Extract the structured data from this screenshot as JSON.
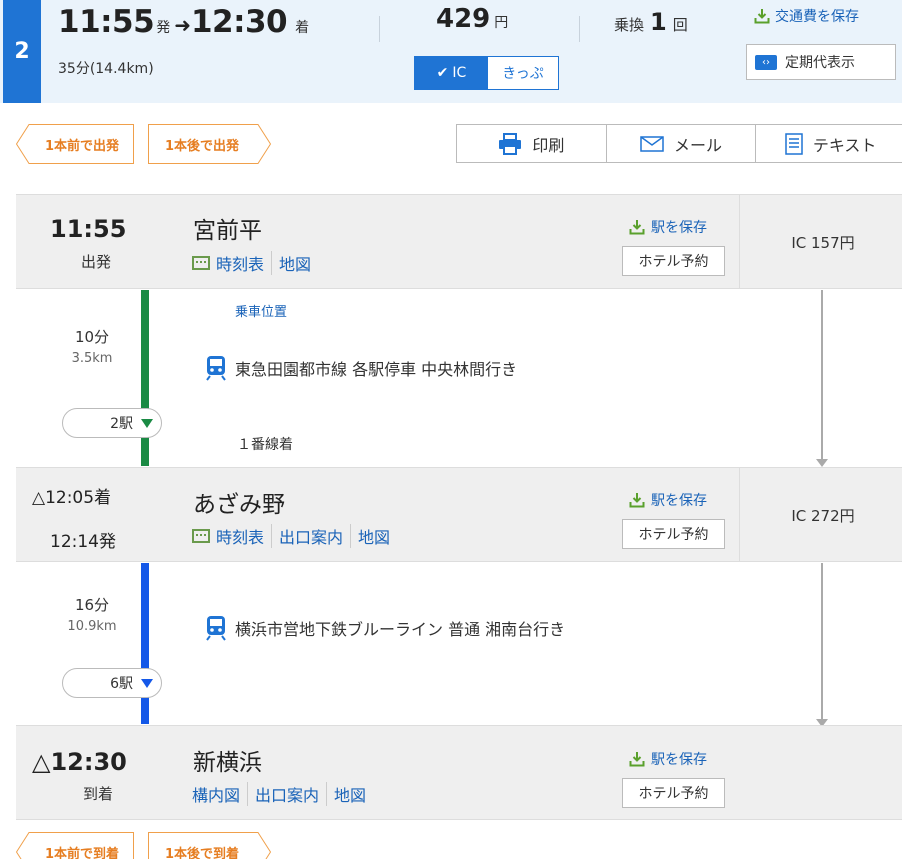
{
  "route": {
    "rank": "2",
    "depart_time": "11:55",
    "depart_suffix": "発",
    "arrive_time": "12:30",
    "arrive_suffix": "着",
    "duration": "35分(14.4km)",
    "fare_amount": "429",
    "fare_unit": "円",
    "transfer_label": "乗換",
    "transfer_count": "1",
    "transfer_unit": "回",
    "save_fare_label": "交通費を保存",
    "teiki_label": "定期代表示",
    "toggle_ic": "IC",
    "toggle_ticket": "きっぷ"
  },
  "nav": {
    "prev_depart": "1本前で出発",
    "next_depart": "1本後で出発",
    "prev_arrive": "1本前で到着",
    "next_arrive": "1本後で到着"
  },
  "actions": {
    "print": "印刷",
    "mail": "メール",
    "text": "テキスト"
  },
  "stations": [
    {
      "time_main": "11:55",
      "time_sub": "出発",
      "name": "宮前平",
      "links": [
        "時刻表",
        "地図"
      ],
      "save_label": "駅を保存",
      "hotel_label": "ホテル予約",
      "ic_fare": "IC 157円"
    },
    {
      "arr_time": "△12:05着",
      "dep_time": "12:14発",
      "name": "あざみ野",
      "links": [
        "時刻表",
        "出口案内",
        "地図"
      ],
      "save_label": "駅を保存",
      "hotel_label": "ホテル予約",
      "ic_fare": "IC 272円"
    },
    {
      "time_main": "△12:30",
      "time_sub": "到着",
      "name": "新横浜",
      "links": [
        "構内図",
        "出口案内",
        "地図"
      ],
      "save_label": "駅を保存",
      "hotel_label": "ホテル予約"
    }
  ],
  "segments": [
    {
      "minutes": "10分",
      "distance": "3.5km",
      "boarding_position": "乗車位置",
      "line": "東急田園都市線 各駅停車 中央林間行き",
      "stops": "2駅",
      "platform": "１番線着",
      "color": "#1a8a44"
    },
    {
      "minutes": "16分",
      "distance": "10.9km",
      "line": "横浜市営地下鉄ブルーライン 普通 湘南台行き",
      "stops": "6駅",
      "color": "#1458e8"
    }
  ],
  "colors": {
    "accent": "#1f74d4",
    "nav_orange": "#e67e22",
    "link": "#1a63b8"
  }
}
